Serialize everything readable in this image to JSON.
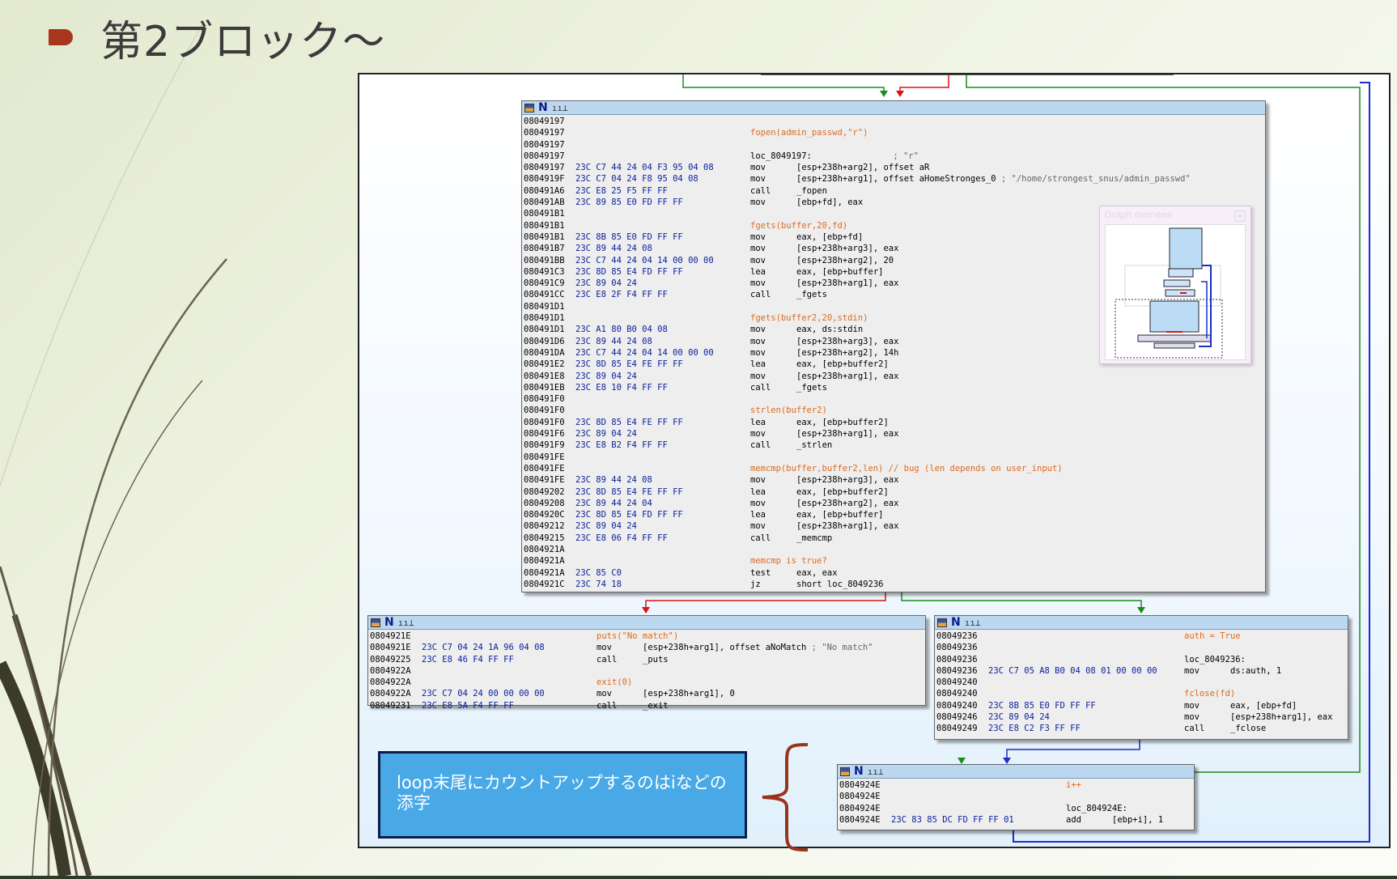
{
  "slide": {
    "title": "第2ブロック〜"
  },
  "callout": {
    "text": "loop末尾にカウントアップするのはiなどの添字"
  },
  "overview": {
    "title": "Graph overview",
    "close_label": "×"
  },
  "blocks": {
    "main": {
      "rows": [
        {
          "a": "08049197",
          "b": "",
          "m": "",
          "o": "",
          "c": ""
        },
        {
          "a": "08049197",
          "b": "",
          "m": "",
          "o": "",
          "c": "fopen(admin_passwd,\"r\")"
        },
        {
          "a": "08049197",
          "b": "",
          "m": "",
          "o": "",
          "c": ""
        },
        {
          "a": "08049197",
          "b": "",
          "m": "loc_8049197:",
          "o": "",
          "c": "",
          "r": "; \"r\""
        },
        {
          "a": "08049197",
          "b": "23C C7 44 24 04 F3 95 04 08",
          "m": "mov",
          "o": "[esp+238h+arg2], offset aR",
          "c": ""
        },
        {
          "a": "0804919F",
          "b": "23C C7 04 24 F8 95 04 08",
          "m": "mov",
          "o": "[esp+238h+arg1], offset aHomeStronges_0",
          "c": "",
          "r": "; \"/home/strongest_snus/admin_passwd\""
        },
        {
          "a": "080491A6",
          "b": "23C E8 25 F5 FF FF",
          "m": "call",
          "o": "_fopen",
          "c": ""
        },
        {
          "a": "080491AB",
          "b": "23C 89 85 E0 FD FF FF",
          "m": "mov",
          "o": "[ebp+fd], eax",
          "c": ""
        },
        {
          "a": "080491B1",
          "b": "",
          "m": "",
          "o": "",
          "c": ""
        },
        {
          "a": "080491B1",
          "b": "",
          "m": "",
          "o": "",
          "c": "fgets(buffer,20,fd)"
        },
        {
          "a": "080491B1",
          "b": "23C 8B 85 E0 FD FF FF",
          "m": "mov",
          "o": "eax, [ebp+fd]",
          "c": ""
        },
        {
          "a": "080491B7",
          "b": "23C 89 44 24 08",
          "m": "mov",
          "o": "[esp+238h+arg3], eax",
          "c": ""
        },
        {
          "a": "080491BB",
          "b": "23C C7 44 24 04 14 00 00 00",
          "m": "mov",
          "o": "[esp+238h+arg2], 20",
          "c": ""
        },
        {
          "a": "080491C3",
          "b": "23C 8D 85 E4 FD FF FF",
          "m": "lea",
          "o": "eax, [ebp+buffer]",
          "c": ""
        },
        {
          "a": "080491C9",
          "b": "23C 89 04 24",
          "m": "mov",
          "o": "[esp+238h+arg1], eax",
          "c": ""
        },
        {
          "a": "080491CC",
          "b": "23C E8 2F F4 FF FF",
          "m": "call",
          "o": "_fgets",
          "c": ""
        },
        {
          "a": "080491D1",
          "b": "",
          "m": "",
          "o": "",
          "c": ""
        },
        {
          "a": "080491D1",
          "b": "",
          "m": "",
          "o": "",
          "c": "fgets(buffer2,20,stdin)"
        },
        {
          "a": "080491D1",
          "b": "23C A1 80 B0 04 08",
          "m": "mov",
          "o": "eax, ds:stdin",
          "c": ""
        },
        {
          "a": "080491D6",
          "b": "23C 89 44 24 08",
          "m": "mov",
          "o": "[esp+238h+arg3], eax",
          "c": ""
        },
        {
          "a": "080491DA",
          "b": "23C C7 44 24 04 14 00 00 00",
          "m": "mov",
          "o": "[esp+238h+arg2], 14h",
          "c": ""
        },
        {
          "a": "080491E2",
          "b": "23C 8D 85 E4 FE FF FF",
          "m": "lea",
          "o": "eax, [ebp+buffer2]",
          "c": ""
        },
        {
          "a": "080491E8",
          "b": "23C 89 04 24",
          "m": "mov",
          "o": "[esp+238h+arg1], eax",
          "c": ""
        },
        {
          "a": "080491EB",
          "b": "23C E8 10 F4 FF FF",
          "m": "call",
          "o": "_fgets",
          "c": ""
        },
        {
          "a": "080491F0",
          "b": "",
          "m": "",
          "o": "",
          "c": ""
        },
        {
          "a": "080491F0",
          "b": "",
          "m": "",
          "o": "",
          "c": "strlen(buffer2)"
        },
        {
          "a": "080491F0",
          "b": "23C 8D 85 E4 FE FF FF",
          "m": "lea",
          "o": "eax, [ebp+buffer2]",
          "c": ""
        },
        {
          "a": "080491F6",
          "b": "23C 89 04 24",
          "m": "mov",
          "o": "[esp+238h+arg1], eax",
          "c": ""
        },
        {
          "a": "080491F9",
          "b": "23C E8 B2 F4 FF FF",
          "m": "call",
          "o": "_strlen",
          "c": ""
        },
        {
          "a": "080491FE",
          "b": "",
          "m": "",
          "o": "",
          "c": ""
        },
        {
          "a": "080491FE",
          "b": "",
          "m": "",
          "o": "",
          "c": "memcmp(buffer,buffer2,len) // bug (len depends on user_input)"
        },
        {
          "a": "080491FE",
          "b": "23C 89 44 24 08",
          "m": "mov",
          "o": "[esp+238h+arg3], eax",
          "c": ""
        },
        {
          "a": "08049202",
          "b": "23C 8D 85 E4 FE FF FF",
          "m": "lea",
          "o": "eax, [ebp+buffer2]",
          "c": ""
        },
        {
          "a": "08049208",
          "b": "23C 89 44 24 04",
          "m": "mov",
          "o": "[esp+238h+arg2], eax",
          "c": ""
        },
        {
          "a": "0804920C",
          "b": "23C 8D 85 E4 FD FF FF",
          "m": "lea",
          "o": "eax, [ebp+buffer]",
          "c": ""
        },
        {
          "a": "08049212",
          "b": "23C 89 04 24",
          "m": "mov",
          "o": "[esp+238h+arg1], eax",
          "c": ""
        },
        {
          "a": "08049215",
          "b": "23C E8 06 F4 FF FF",
          "m": "call",
          "o": "_memcmp",
          "c": ""
        },
        {
          "a": "0804921A",
          "b": "",
          "m": "",
          "o": "",
          "c": ""
        },
        {
          "a": "0804921A",
          "b": "",
          "m": "",
          "o": "",
          "c": "memcmp is true?"
        },
        {
          "a": "0804921A",
          "b": "23C 85 C0",
          "m": "test",
          "o": "eax, eax",
          "c": ""
        },
        {
          "a": "0804921C",
          "b": "23C 74 18",
          "m": "jz",
          "o": "short loc_8049236",
          "c": ""
        }
      ]
    },
    "nomatch": {
      "rows": [
        {
          "a": "0804921E",
          "b": "",
          "m": "",
          "o": "",
          "c": "puts(\"No match\")"
        },
        {
          "a": "0804921E",
          "b": "23C C7 04 24 1A 96 04 08",
          "m": "mov",
          "o": "[esp+238h+arg1], offset aNoMatch",
          "c": "",
          "r": "; \"No match\""
        },
        {
          "a": "08049225",
          "b": "23C E8 46 F4 FF FF",
          "m": "call",
          "o": "_puts",
          "c": ""
        },
        {
          "a": "0804922A",
          "b": "",
          "m": "",
          "o": "",
          "c": ""
        },
        {
          "a": "0804922A",
          "b": "",
          "m": "",
          "o": "",
          "c": "exit(0)"
        },
        {
          "a": "0804922A",
          "b": "23C C7 04 24 00 00 00 00",
          "m": "mov",
          "o": "[esp+238h+arg1], 0",
          "c": ""
        },
        {
          "a": "08049231",
          "b": "23C E8 5A F4 FF FF",
          "m": "call",
          "o": "_exit",
          "c": ""
        }
      ]
    },
    "auth": {
      "rows": [
        {
          "a": "08049236",
          "b": "",
          "m": "",
          "o": "",
          "c": "auth = True"
        },
        {
          "a": "08049236",
          "b": "",
          "m": "",
          "o": "",
          "c": ""
        },
        {
          "a": "08049236",
          "b": "",
          "m": "loc_8049236:",
          "o": "",
          "c": ""
        },
        {
          "a": "08049236",
          "b": "23C C7 05 A8 B0 04 08 01 00 00 00",
          "m": "mov",
          "o": "ds:auth, 1",
          "c": ""
        },
        {
          "a": "08049240",
          "b": "",
          "m": "",
          "o": "",
          "c": ""
        },
        {
          "a": "08049240",
          "b": "",
          "m": "",
          "o": "",
          "c": "fclose(fd)"
        },
        {
          "a": "08049240",
          "b": "23C 8B 85 E0 FD FF FF",
          "m": "mov",
          "o": "eax, [ebp+fd]",
          "c": ""
        },
        {
          "a": "08049246",
          "b": "23C 89 04 24",
          "m": "mov",
          "o": "[esp+238h+arg1], eax",
          "c": ""
        },
        {
          "a": "08049249",
          "b": "23C E8 C2 F3 FF FF",
          "m": "call",
          "o": "_fclose",
          "c": ""
        }
      ]
    },
    "inc": {
      "rows": [
        {
          "a": "0804924E",
          "b": "",
          "m": "",
          "o": "",
          "c": "i++"
        },
        {
          "a": "0804924E",
          "b": "",
          "m": "",
          "o": "",
          "c": ""
        },
        {
          "a": "0804924E",
          "b": "",
          "m": "loc_804924E:",
          "o": "",
          "c": ""
        },
        {
          "a": "0804924E",
          "b": "23C 83 85 DC FD FF FF 01",
          "m": "add",
          "o": "[ebp+i], 1",
          "c": ""
        }
      ]
    }
  },
  "colors": {
    "edge_true": "#1a8c1a",
    "edge_false": "#e01010",
    "edge_flow": "#1a2ec8",
    "comment": "#de6a1e",
    "bytes": "#0a1f9c"
  }
}
